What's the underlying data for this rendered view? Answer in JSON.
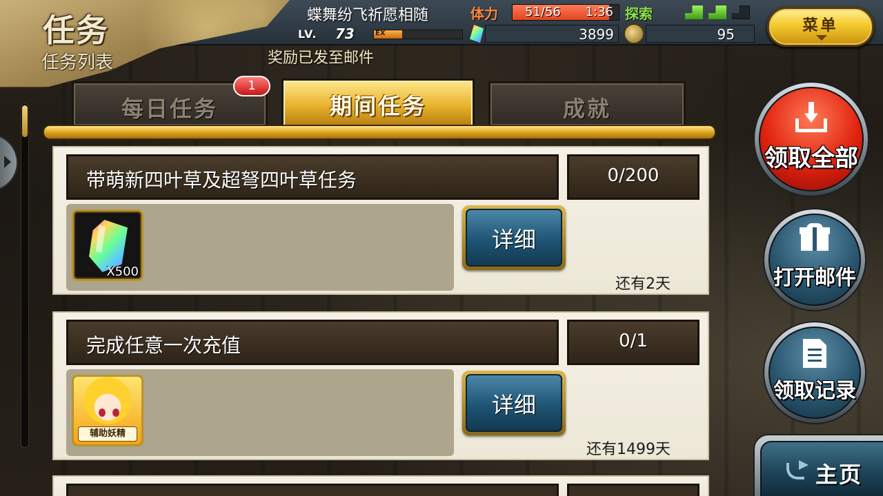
{
  "header": {
    "title": "任务",
    "subtitle": "任务列表",
    "player_name": "蝶舞纷飞祈愿相随",
    "level_label": "LV.",
    "level": "73",
    "exp_tag": "EX",
    "exp_progress": 0.32,
    "stamina_label": "体力",
    "stamina_text": "51/56",
    "stamina_fraction": 0.91,
    "stamina_timer": "1:36",
    "explore_label": "探索",
    "explore_pips": [
      true,
      true,
      false
    ],
    "gems": "3899",
    "medals": "95",
    "menu_label": "菜单",
    "notice": "奖励已发至邮件"
  },
  "tabs": [
    {
      "label": "每日任务",
      "active": false
    },
    {
      "label": "期间任务",
      "active": true
    },
    {
      "label": "成就",
      "active": false
    }
  ],
  "badge": "1",
  "quests": [
    {
      "title": "带萌新四叶草及超弩四叶草任务",
      "progress": "0/200",
      "reward_icon": "rainbow-crystal-icon",
      "reward_qty": "X500",
      "detail_label": "详细",
      "time_left": "还有2天"
    },
    {
      "title": "完成任意一次充值",
      "progress": "0/1",
      "reward_icon": "assist-fairy-portrait",
      "reward_label": "辅助妖精",
      "detail_label": "详细",
      "time_left": "还有1499天"
    }
  ],
  "side_buttons": {
    "claim_all": "领取全部",
    "open_mail": "打开邮件",
    "claim_log": "领取记录"
  },
  "home_label": "主页",
  "colors": {
    "gold": "#e8b22a",
    "claim_red": "#e0220f",
    "button_blue": "#2a5670",
    "stamina_orange": "#ff7a56",
    "explore_green": "#8ee04a"
  }
}
